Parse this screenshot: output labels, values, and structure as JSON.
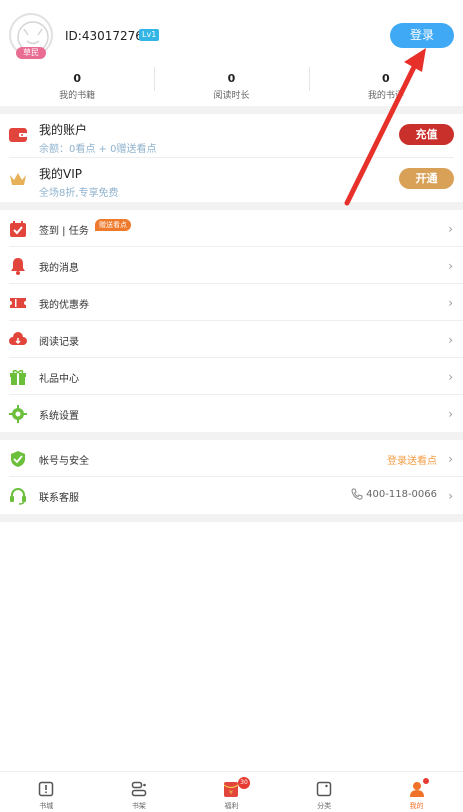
{
  "profile": {
    "rank_label": "草民",
    "user_id": "ID:430172764",
    "level": "Lv1",
    "login_label": "登录"
  },
  "stats": [
    {
      "value": "0",
      "label": "我的书籍"
    },
    {
      "value": "0",
      "label": "阅读时长"
    },
    {
      "value": "0",
      "label": "我的书评"
    }
  ],
  "account": {
    "title": "我的账户",
    "balance": "余额：0看点 + 0赠送看点",
    "recharge_label": "充值",
    "vip_title": "我的VIP",
    "vip_sub": "全场8折,专享免费",
    "vip_button": "开通"
  },
  "menu1": [
    {
      "label": "签到 | 任务",
      "icon": "calendar-check-icon",
      "badge": "赠送看点"
    },
    {
      "label": "我的消息",
      "icon": "bell-icon"
    },
    {
      "label": "我的优惠券",
      "icon": "ticket-icon"
    },
    {
      "label": "阅读记录",
      "icon": "cloud-download-icon"
    },
    {
      "label": "礼品中心",
      "icon": "gift-icon"
    },
    {
      "label": "系统设置",
      "icon": "gear-icon"
    }
  ],
  "menu2": [
    {
      "label": "帐号与安全",
      "icon": "shield-check-icon",
      "right": "登录送看点"
    },
    {
      "label": "联系客服",
      "icon": "headset-icon",
      "right": "400-118-0066"
    }
  ],
  "chevron": "›",
  "nav": [
    {
      "label": "书城",
      "icon": "book-icon"
    },
    {
      "label": "书架",
      "icon": "bookshelf-icon"
    },
    {
      "label": "福利",
      "icon": "red-envelope-icon",
      "count": "30"
    },
    {
      "label": "分类",
      "icon": "category-icon"
    },
    {
      "label": "我的",
      "icon": "user-icon"
    }
  ],
  "colors": {
    "accent_blue": "#3fa9f5",
    "recharge_red": "#c9302c",
    "vip_gold": "#d8a157",
    "active_orange": "#f0712a",
    "annotation_arrow": "#e8302a"
  }
}
